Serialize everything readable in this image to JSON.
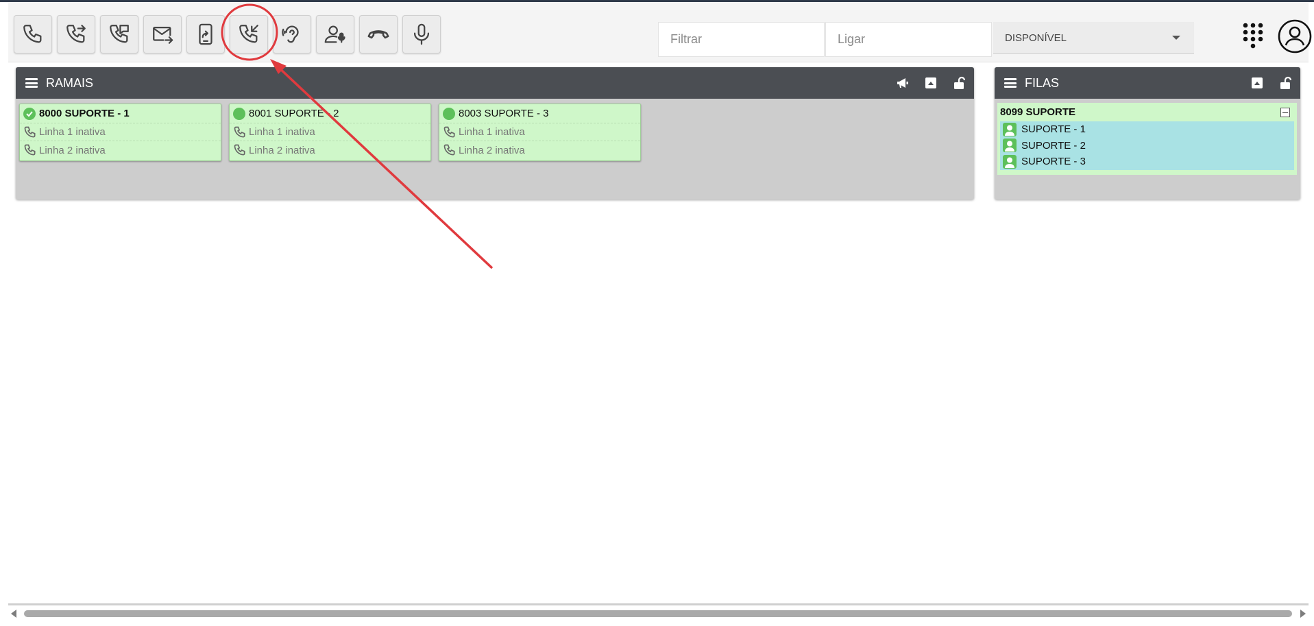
{
  "toolbar": {
    "buttons": [
      {
        "name": "call-button",
        "icon": "phone-icon"
      },
      {
        "name": "transfer-button",
        "icon": "phone-forward-icon"
      },
      {
        "name": "consult-transfer-button",
        "icon": "phone-message-icon"
      },
      {
        "name": "email-forward-button",
        "icon": "mail-forward-icon"
      },
      {
        "name": "mobile-transfer-button",
        "icon": "mobile-forward-icon"
      },
      {
        "name": "pickup-call-button",
        "icon": "phone-incoming-icon"
      },
      {
        "name": "listen-button",
        "icon": "ear-icon"
      },
      {
        "name": "whisper-button",
        "icon": "user-mic-icon"
      },
      {
        "name": "hangup-button",
        "icon": "phone-hangup-icon"
      },
      {
        "name": "microphone-button",
        "icon": "microphone-icon"
      }
    ],
    "filter_placeholder": "Filtrar",
    "dial_placeholder": "Ligar",
    "status_selected": "DISPONÍVEL"
  },
  "ramais": {
    "title": "RAMAIS",
    "extensions": [
      {
        "title": "8000 SUPORTE - 1",
        "status": "check",
        "bold": true,
        "lines": [
          "Linha 1 inativa",
          "Linha 2 inativa"
        ]
      },
      {
        "title": "8001 SUPORTE - 2",
        "status": "online",
        "bold": false,
        "lines": [
          "Linha 1 inativa",
          "Linha 2 inativa"
        ]
      },
      {
        "title": "8003 SUPORTE - 3",
        "status": "online",
        "bold": false,
        "lines": [
          "Linha 1 inativa",
          "Linha 2 inativa"
        ]
      }
    ]
  },
  "filas": {
    "title": "FILAS",
    "queue": {
      "title": "8099 SUPORTE",
      "members": [
        "SUPORTE - 1",
        "SUPORTE - 2",
        "SUPORTE - 3"
      ]
    }
  },
  "colors": {
    "header": "#4b4e53",
    "card_bg": "#cff7c9",
    "queue_list_bg": "#a9e2e4",
    "status_green": "#5dc05a",
    "annotation_red": "#e03a3e"
  }
}
